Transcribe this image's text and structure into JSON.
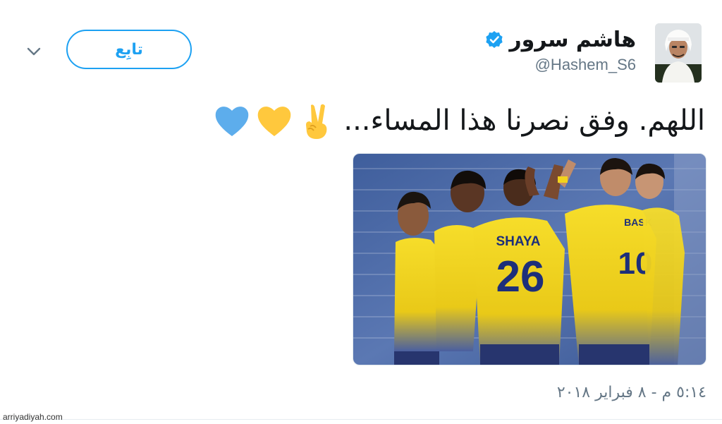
{
  "author": {
    "display_name": "هاشم سرور",
    "handle": "@Hashem_S6",
    "verified_icon": "verified-badge-icon",
    "avatar_icon": "person-avatar"
  },
  "actions": {
    "follow_label": "تابِع",
    "menu_icon": "chevron-down-icon"
  },
  "tweet": {
    "text": "اللهم. وفق نصرنا هذا المساء...",
    "emojis": [
      "victory-hand-icon",
      "yellow-heart-icon",
      "blue-heart-icon"
    ],
    "media": {
      "jersey_name": "SHAYA",
      "jersey_number": "26",
      "second_number": "10",
      "second_name": "BASK"
    },
    "timestamp": "٥:١٤ م - ٨ فبراير ٢٠١٨"
  },
  "watermark": "arriyadiyah.com",
  "colors": {
    "accent": "#1da1f2",
    "jersey_yellow": "#f2d31c",
    "jersey_blue": "#1d2f7a",
    "heart_yellow": "#ffc83d",
    "heart_blue": "#5dadec"
  }
}
